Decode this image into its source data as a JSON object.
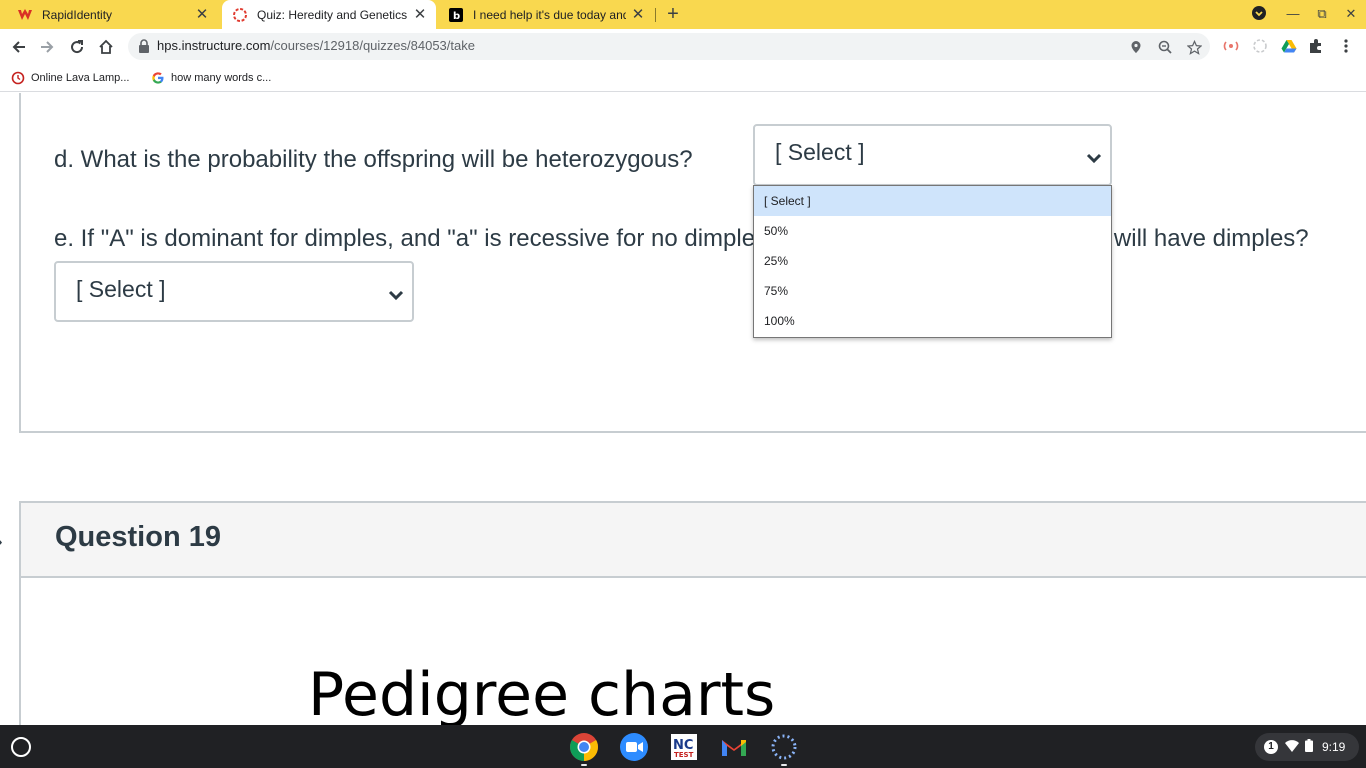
{
  "browser": {
    "tabs": [
      {
        "title": "RapidIdentity",
        "icon": "rapididentity-icon",
        "active": false
      },
      {
        "title": "Quiz: Heredity and Genetics Test",
        "icon": "canvas-icon",
        "active": true
      },
      {
        "title": "I need help it's due today and i don't",
        "icon": "brainly-icon",
        "active": false
      }
    ],
    "url_host": "hps.instructure.com",
    "url_path": "/courses/12918/quizzes/84053/take",
    "bookmarks": [
      {
        "label": "Online Lava Lamp...",
        "icon": "lava-lamp-icon"
      },
      {
        "label": "how many words c...",
        "icon": "google-icon"
      }
    ]
  },
  "quiz": {
    "question_d": "d. What is the probability the offspring will be heterozygous?",
    "question_e": "e. If \"A\" is dominant for dimples, and \"a\" is recessive for no dimples, what is the probability the child will have dimples?",
    "select_d_value": "[ Select ]",
    "select_e_value": "[ Select ]",
    "dropdown_options": [
      "[ Select ]",
      "50%",
      "25%",
      "75%",
      "100%"
    ],
    "selected_option_index": 0,
    "question_19_title": "Question 19",
    "question_19_image_text": "Pedigree charts"
  },
  "shelf": {
    "apps": [
      "chrome-icon",
      "zoom-icon",
      "nc-test-icon",
      "gmail-icon",
      "loading-app-icon"
    ],
    "notification_count": "1",
    "time": "9:19"
  },
  "colors": {
    "tabstrip": "#f9d84f",
    "dropdown_highlight": "#cfe4fb",
    "canvas_text": "#2d3b45"
  }
}
